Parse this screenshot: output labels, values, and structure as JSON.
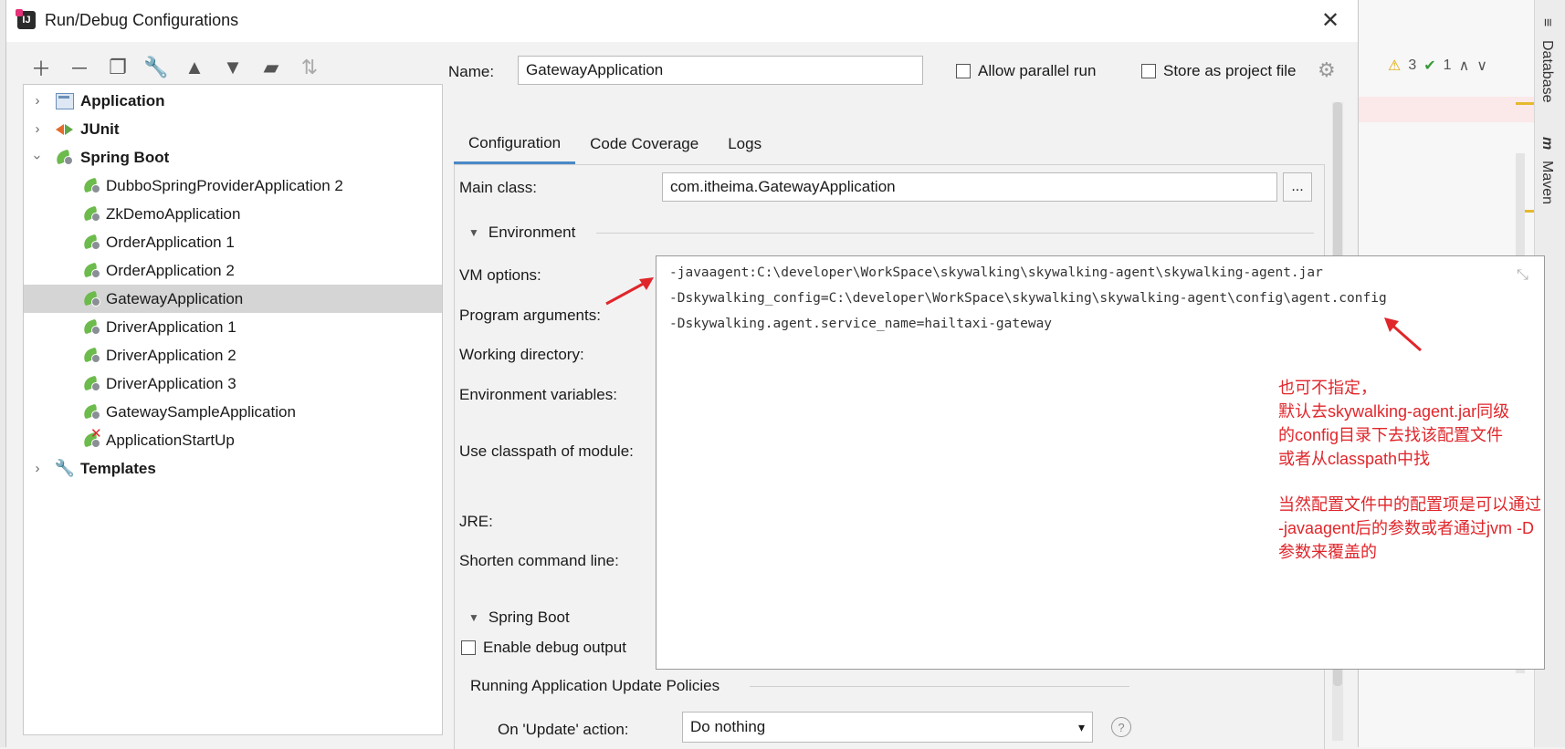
{
  "dialog": {
    "title": "Run/Debug Configurations",
    "name_label": "Name:",
    "name_value": "GatewayApplication",
    "allow_parallel_run": "Allow parallel run",
    "store_as_project_file": "Store as project file"
  },
  "tree": {
    "groups": [
      {
        "label": "Application",
        "expanded": false
      },
      {
        "label": "JUnit",
        "expanded": false
      },
      {
        "label": "Spring Boot",
        "expanded": true
      },
      {
        "label": "Templates",
        "expanded": false
      }
    ],
    "spring_items": [
      "DubboSpringProviderApplication 2",
      "ZkDemoApplication",
      "OrderApplication 1",
      "OrderApplication 2",
      "GatewayApplication",
      "DriverApplication 1",
      "DriverApplication 2",
      "DriverApplication 3",
      "GatewaySampleApplication",
      "ApplicationStartUp"
    ],
    "selected": "GatewayApplication"
  },
  "tabs": [
    {
      "label": "Configuration",
      "active": true
    },
    {
      "label": "Code Coverage",
      "active": false
    },
    {
      "label": "Logs",
      "active": false
    }
  ],
  "config": {
    "main_class_label": "Main class:",
    "main_class_value": "com.itheima.GatewayApplication",
    "ellipsis": "...",
    "environment": "Environment",
    "vm_options_label": "VM options:",
    "program_arguments_label": "Program arguments:",
    "working_directory_label": "Working directory:",
    "environment_variables_label": "Environment variables:",
    "classpath_module_label": "Use classpath of module:",
    "jre_label": "JRE:",
    "shorten_label": "Shorten command line:",
    "spring_boot_section": "Spring Boot",
    "enable_debug_output": "Enable debug output",
    "update_policies": "Running Application Update Policies",
    "on_update_label": "On 'Update' action:",
    "on_update_value": "Do nothing"
  },
  "vm_options": {
    "lines": [
      "-javaagent:C:\\developer\\WorkSpace\\skywalking\\skywalking-agent\\skywalking-agent.jar",
      "-Dskywalking_config=C:\\developer\\WorkSpace\\skywalking\\skywalking-agent\\config\\agent.config",
      "-Dskywalking.agent.service_name=hailtaxi-gateway"
    ]
  },
  "annotation": {
    "lines_a": [
      "也可不指定，",
      "默认去skywalking-agent.jar同级",
      "的config目录下去找该配置文件",
      "或者从classpath中找"
    ],
    "lines_b": [
      "当然配置文件中的配置项是可以通过",
      "-javaagent后的参数或者通过jvm -D",
      "参数来覆盖的"
    ],
    "color": "#e0262b"
  },
  "ide": {
    "warnings": "3",
    "ok": "1",
    "database_tab": "Database",
    "maven_tab": "Maven"
  },
  "colors": {
    "accent": "#4a88c7",
    "selection": "#d5d5d5",
    "leaf_green": "#6cbb4c"
  }
}
